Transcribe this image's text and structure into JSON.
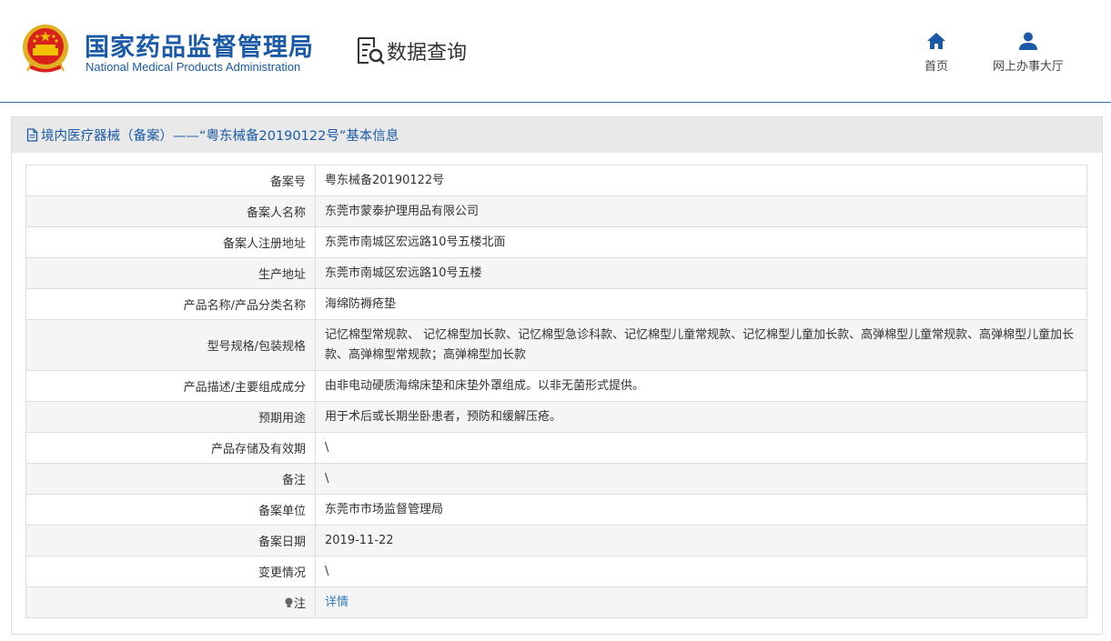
{
  "header": {
    "brand_cn": "国家药品监督管理局",
    "brand_en": "National Medical Products Administration",
    "section_title": "数据查询",
    "nav": [
      {
        "label": "首页",
        "icon": "home-icon"
      },
      {
        "label": "网上办事大厅",
        "icon": "user-icon"
      }
    ]
  },
  "panel": {
    "title": "境内医疗器械（备案）——“粤东械备20190122号”基本信息",
    "title_icon": "document-icon"
  },
  "rows": [
    {
      "label": "备案号",
      "value": "粤东械备20190122号"
    },
    {
      "label": "备案人名称",
      "value": "东莞市蒙泰护理用品有限公司"
    },
    {
      "label": "备案人注册地址",
      "value": "东莞市南城区宏远路10号五楼北面"
    },
    {
      "label": "生产地址",
      "value": "东莞市南城区宏远路10号五楼"
    },
    {
      "label": "产品名称/产品分类名称",
      "value": "海绵防褥疮垫"
    },
    {
      "label": "型号规格/包装规格",
      "value": "记忆棉型常规款、 记忆棉型加长款、记忆棉型急诊科款、记忆棉型儿童常规款、记忆棉型儿童加长款、高弹棉型儿童常规款、高弹棉型儿童加长款、高弹棉型常规款；高弹棉型加长款"
    },
    {
      "label": "产品描述/主要组成成分",
      "value": "由非电动硬质海绵床垫和床垫外罩组成。以非无菌形式提供。"
    },
    {
      "label": "预期用途",
      "value": "用于术后或长期坐卧患者，预防和缓解压疮。"
    },
    {
      "label": "产品存储及有效期",
      "value": "\\"
    },
    {
      "label": "备注",
      "value": "\\"
    },
    {
      "label": "备案单位",
      "value": "东莞市市场监督管理局"
    },
    {
      "label": "备案日期",
      "value": "2019-11-22"
    },
    {
      "label": "变更情况",
      "value": "\\"
    },
    {
      "label": "注",
      "value": "详情"
    }
  ],
  "colors": {
    "brand_blue": "#1a5aa6",
    "link_blue": "#2f7bbf",
    "emblem_red": "#d8211c",
    "emblem_gold": "#f2c200"
  }
}
